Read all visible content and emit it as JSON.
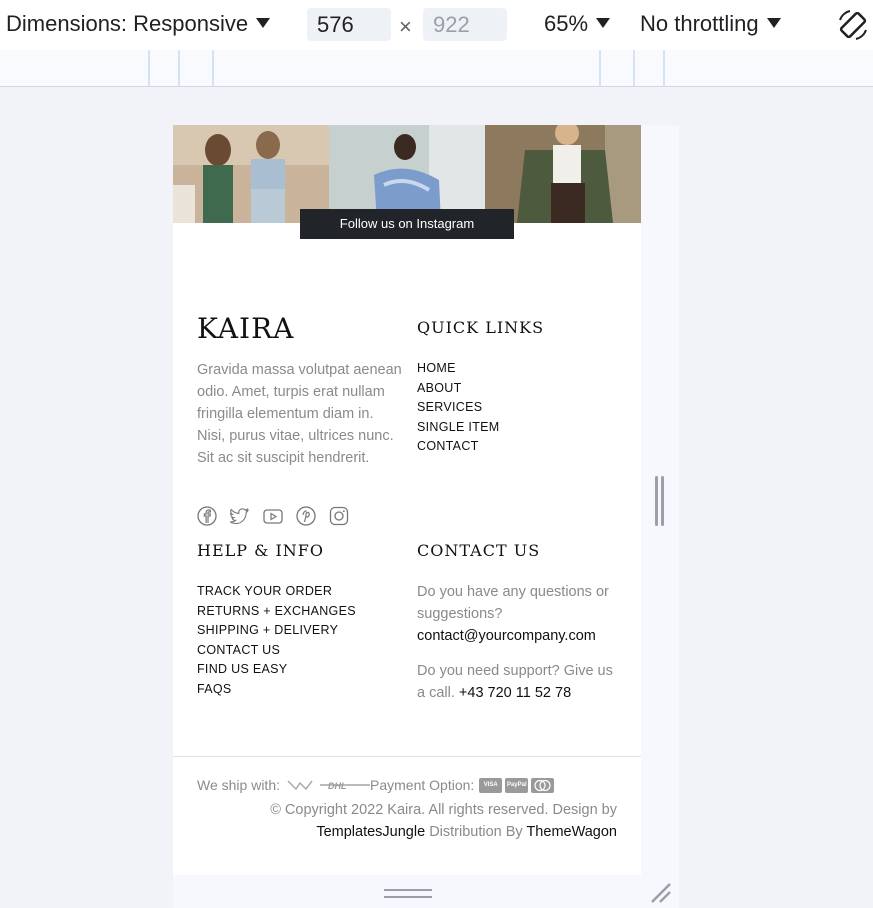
{
  "devtools": {
    "dimensions_label": "Dimensions: Responsive",
    "width_value": "576",
    "height_placeholder": "922",
    "times_symbol": "×",
    "zoom_label": "65%",
    "throttling_label": "No throttling",
    "rotate_icon": "rotate-device-icon"
  },
  "page": {
    "instagram_button": "Follow us on Instagram",
    "logo": "KAIRA",
    "about_text": "Gravida massa volutpat aenean odio. Amet, turpis erat nullam fringilla elementum diam in. Nisi, purus vitae, ultrices nunc. Sit ac sit suscipit hendrerit.",
    "social_icons": [
      "facebook-icon",
      "twitter-icon",
      "youtube-icon",
      "pinterest-icon",
      "instagram-icon"
    ],
    "quick_links": {
      "title": "QUICK LINKS",
      "items": [
        "HOME",
        "ABOUT",
        "SERVICES",
        "SINGLE ITEM",
        "CONTACT"
      ]
    },
    "help_info": {
      "title": "HELP & INFO",
      "items": [
        "TRACK YOUR ORDER",
        "RETURNS + EXCHANGES",
        "SHIPPING + DELIVERY",
        "CONTACT US",
        "FIND US EASY",
        "FAQS"
      ]
    },
    "contact": {
      "title": "CONTACT US",
      "question": "Do you have any questions or suggestions?",
      "email": "contact@yourcompany.com",
      "support": "Do you need support? Give us a call.",
      "phone": "+43 720 11 52 78"
    },
    "footer": {
      "ship_label": "We ship with:",
      "payment_label": "Payment Option:",
      "cards": [
        "VISA",
        "PayPal",
        "MC"
      ],
      "copyright": "© Copyright 2022 Kaira. All rights reserved. Design by",
      "design_link": "TemplatesJungle",
      "distribution": "Distribution By",
      "distributor_link": "ThemeWagon"
    }
  }
}
